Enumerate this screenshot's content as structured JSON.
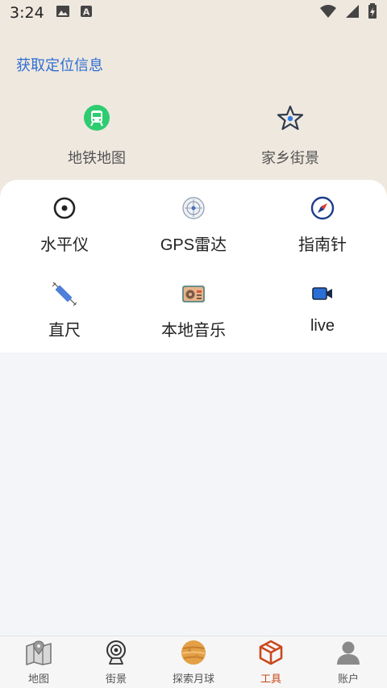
{
  "status_bar": {
    "time": "3:24",
    "icons": [
      "image-icon",
      "font-icon",
      "wifi-icon",
      "signal-icon",
      "battery-charging-icon"
    ]
  },
  "header": {
    "location_link": "获取定位信息"
  },
  "quick_links": [
    {
      "label": "地铁地图",
      "icon": "metro-icon",
      "color": "#2ecc71"
    },
    {
      "label": "家乡街景",
      "icon": "star-icon",
      "color": "#2f3a4a"
    }
  ],
  "tools": [
    {
      "label": "水平仪",
      "icon": "level-icon"
    },
    {
      "label": "GPS雷达",
      "icon": "radar-icon"
    },
    {
      "label": "指南针",
      "icon": "compass-icon"
    },
    {
      "label": "直尺",
      "icon": "ruler-icon"
    },
    {
      "label": "本地音乐",
      "icon": "radio-icon"
    },
    {
      "label": "live",
      "icon": "video-camera-icon"
    }
  ],
  "bottom_nav": {
    "active_index": 3,
    "active_color": "#c9491d",
    "items": [
      {
        "label": "地图",
        "icon": "map-icon"
      },
      {
        "label": "街景",
        "icon": "webcam-icon"
      },
      {
        "label": "探索月球",
        "icon": "moon-icon"
      },
      {
        "label": "工具",
        "icon": "toolbox-cube-icon"
      },
      {
        "label": "账户",
        "icon": "user-icon"
      }
    ]
  }
}
